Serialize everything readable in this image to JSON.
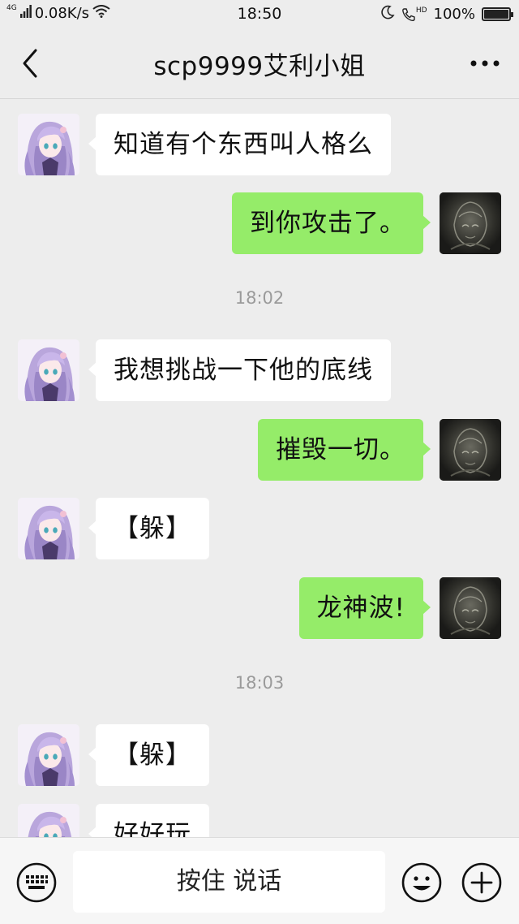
{
  "status_bar": {
    "network_type": "4G",
    "speed": "0.08K/s",
    "time": "18:50",
    "hd_label": "HD",
    "battery": "100%",
    "battery_level": 1.0
  },
  "header": {
    "title": "scp9999艾利小姐"
  },
  "messages": [
    {
      "side": "left",
      "text": "知道有个东西叫人格么"
    },
    {
      "side": "right",
      "text": "到你攻击了。"
    },
    {
      "type": "time",
      "text": "18:02"
    },
    {
      "side": "left",
      "text": "我想挑战一下他的底线"
    },
    {
      "side": "right",
      "text": "摧毁一切。"
    },
    {
      "side": "left",
      "text": "【躲】"
    },
    {
      "side": "right",
      "text": "龙神波!"
    },
    {
      "type": "time",
      "text": "18:03"
    },
    {
      "side": "left",
      "text": "【躲】"
    },
    {
      "side": "left",
      "text": "好好玩"
    }
  ],
  "input_bar": {
    "hold_to_talk": "按住 说话"
  },
  "colors": {
    "background": "#ededed",
    "sent_bubble": "#95ec69",
    "received_bubble": "#ffffff",
    "timestamp": "#9a9a9a"
  }
}
